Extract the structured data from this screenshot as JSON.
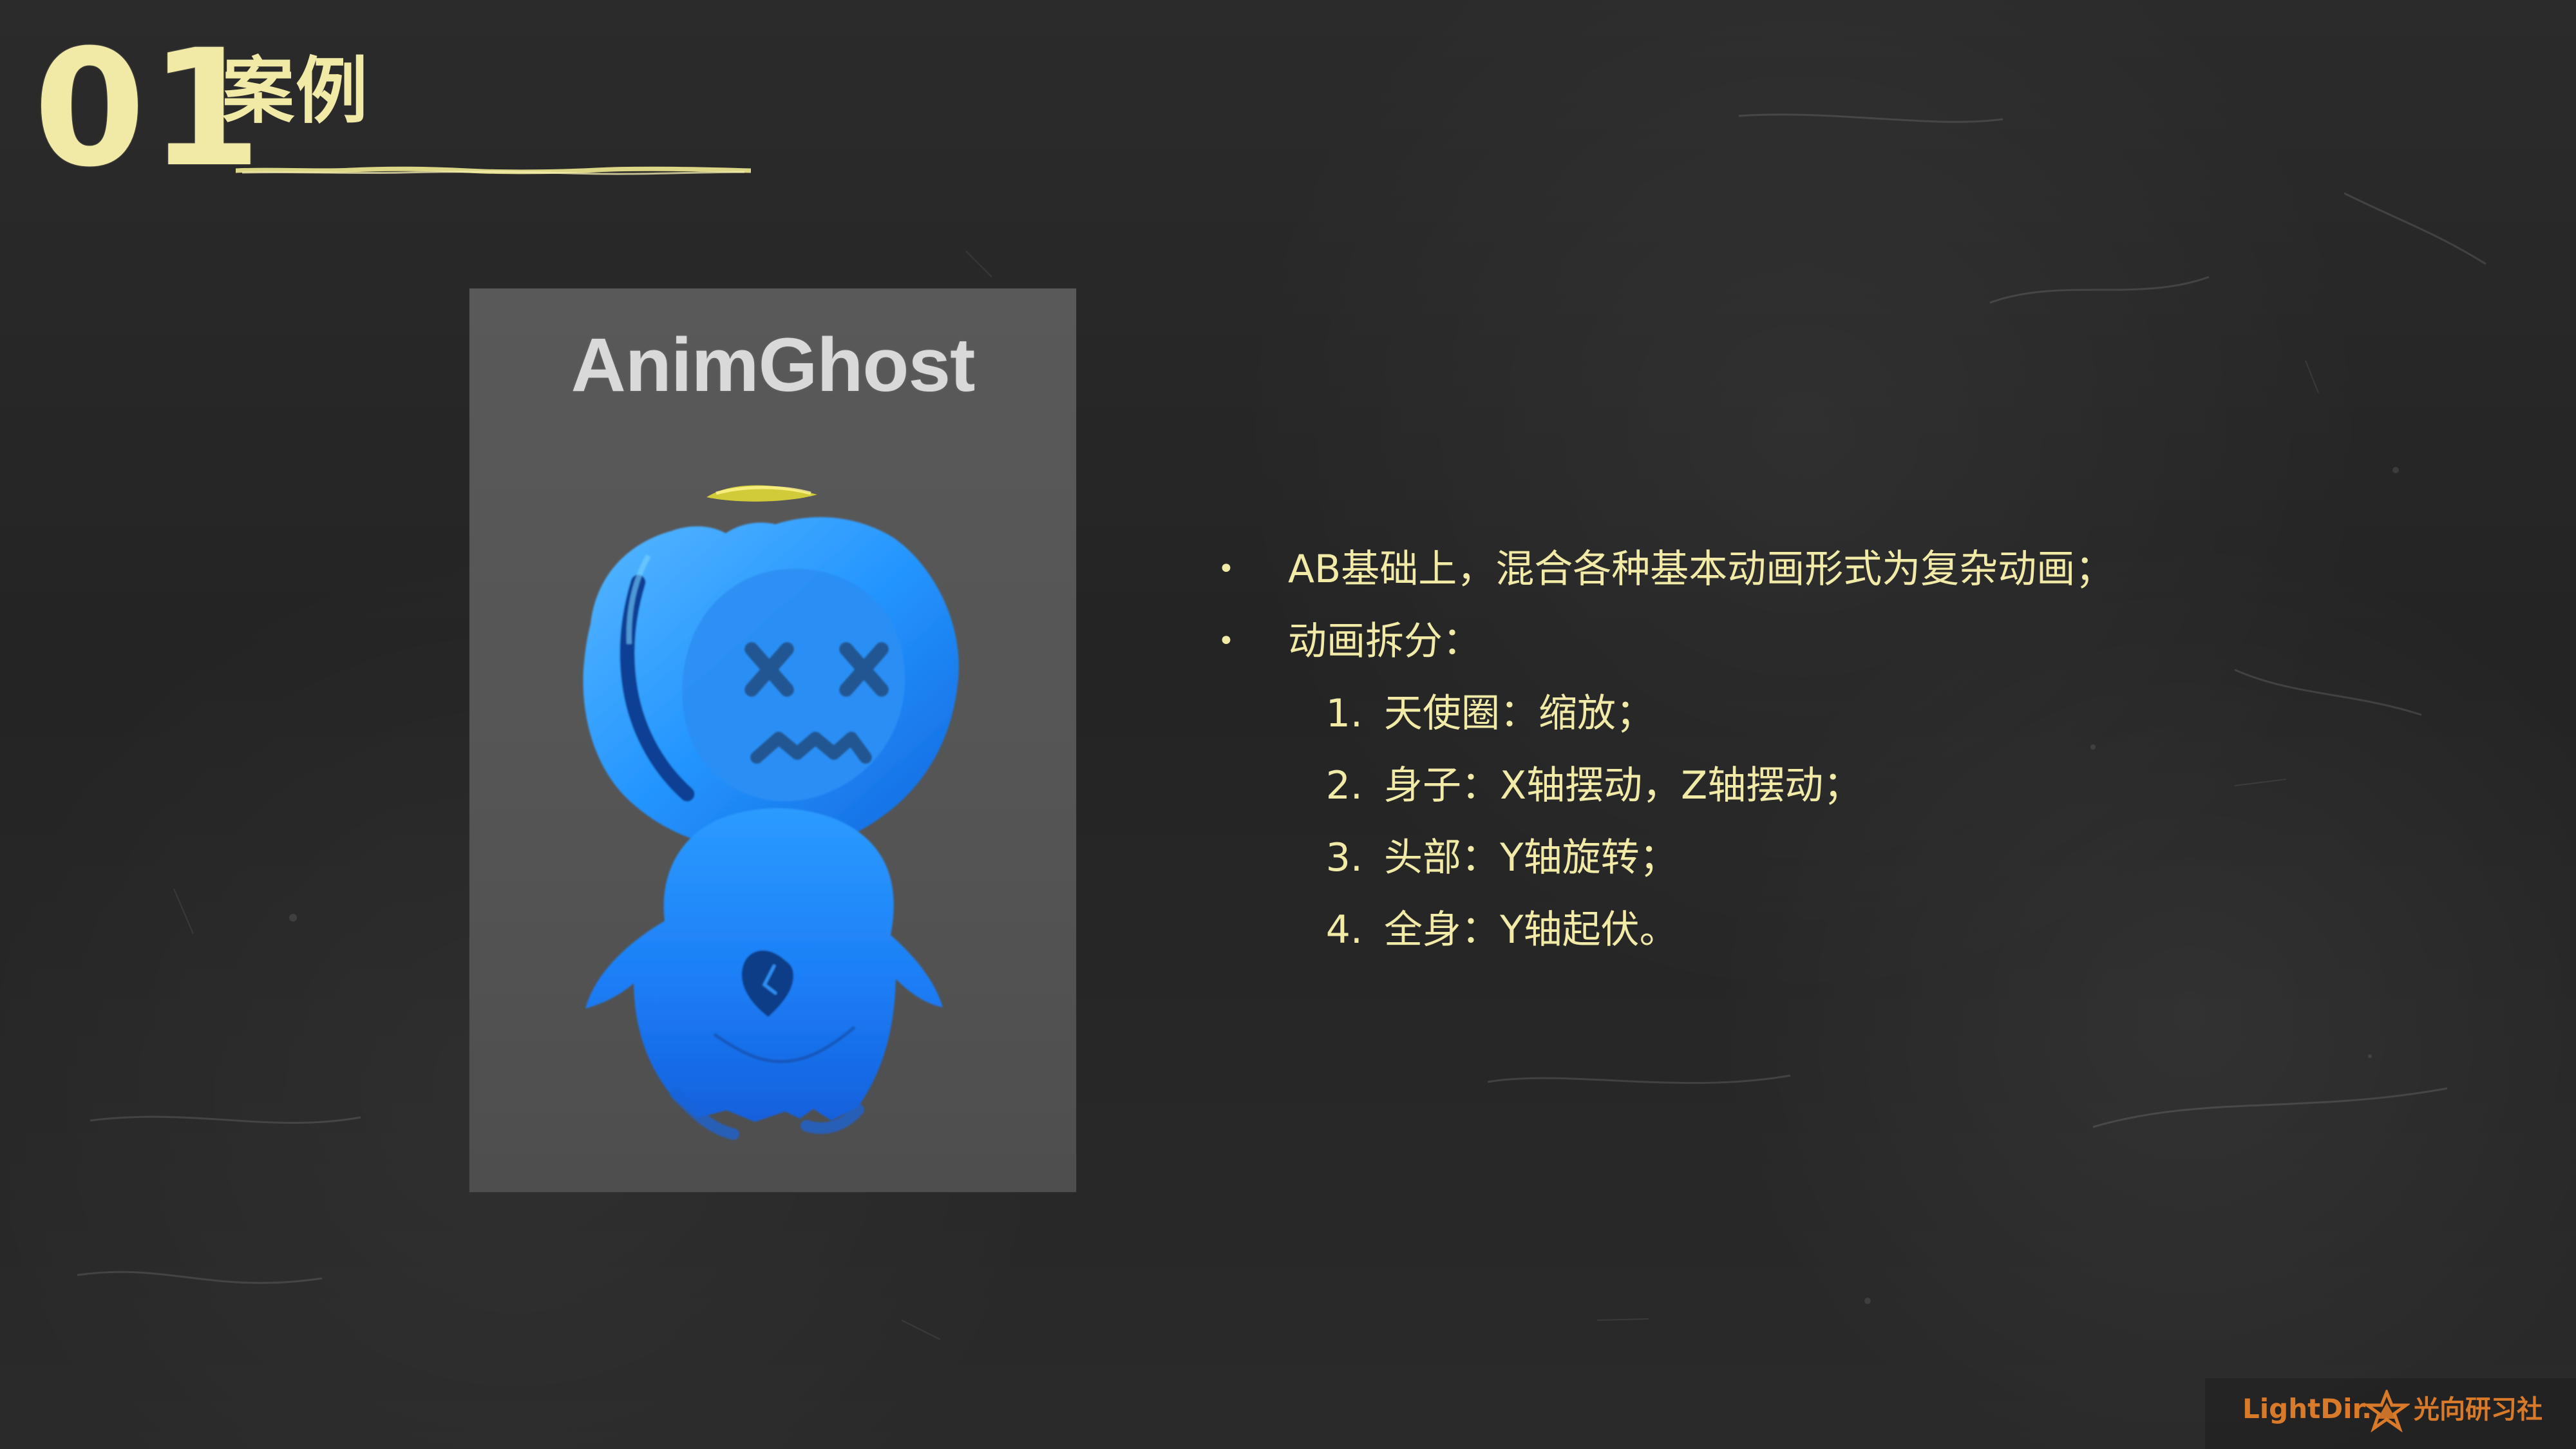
{
  "header": {
    "slide_number": "01",
    "title": "案例"
  },
  "scene": {
    "title": "AnimGhost"
  },
  "content": {
    "bullets": [
      "AB基础上，混合各种基本动画形式为复杂动画；",
      "动画拆分："
    ],
    "sub_items": [
      {
        "index": "1.",
        "text": "天使圈：缩放；"
      },
      {
        "index": "2.",
        "text": "身子：X轴摆动，Z轴摆动；"
      },
      {
        "index": "3.",
        "text": "头部：Y轴旋转；"
      },
      {
        "index": "4.",
        "text": "全身：Y轴起伏。"
      }
    ]
  },
  "brand": {
    "left": "LightDir.",
    "right": "光向研习社"
  },
  "colors": {
    "chalk_yellow": "#f2eba8",
    "ghost_blue": "#1d8fff",
    "panel_gray": "#555555",
    "brand_orange": "#d97a2a"
  },
  "icons": {
    "ghost": "ghost-icon",
    "halo": "halo-icon",
    "brand": "star-logo-icon"
  }
}
